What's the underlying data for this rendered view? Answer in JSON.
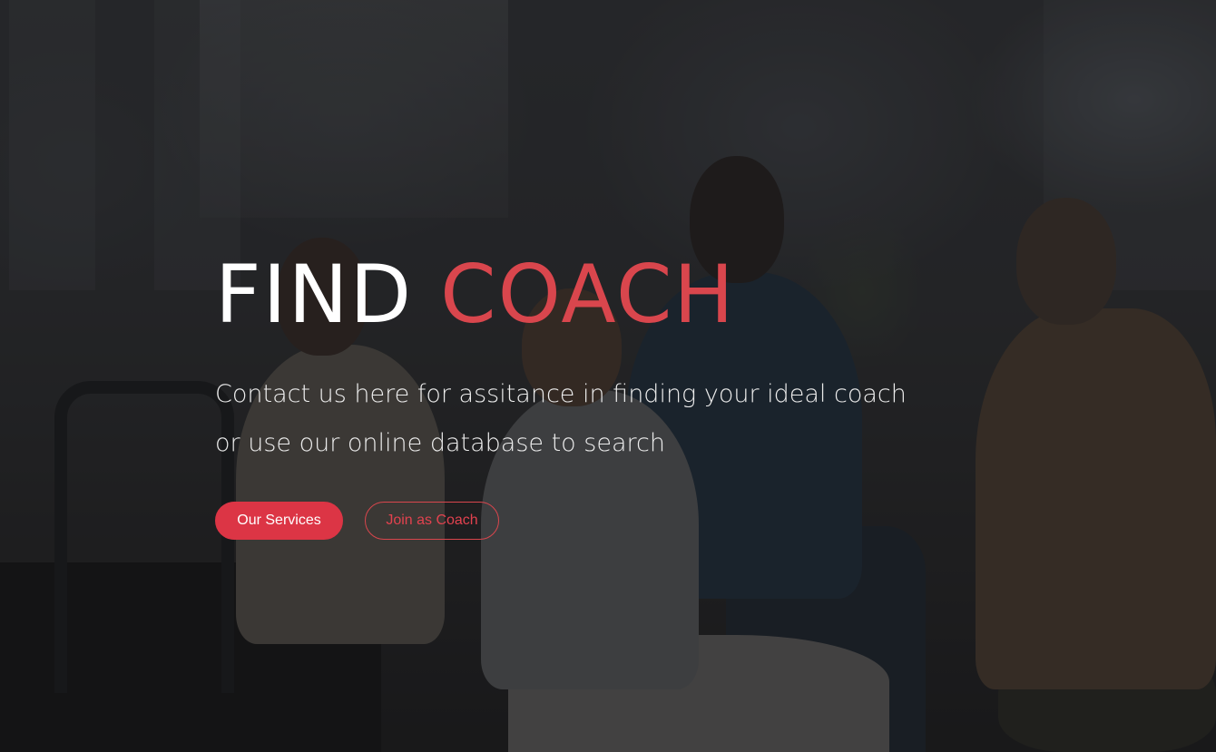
{
  "hero": {
    "title_part1": "FIND",
    "title_part2": "COACH",
    "subtitle_line1": "Contact us here for assitance in finding your ideal coach",
    "subtitle_line2": "or use our online database to search",
    "primary_button": "Our Services",
    "secondary_button": "Join as Coach"
  },
  "colors": {
    "accent": "#dc3545",
    "title_accent": "#d9464d",
    "text": "#ffffff"
  }
}
